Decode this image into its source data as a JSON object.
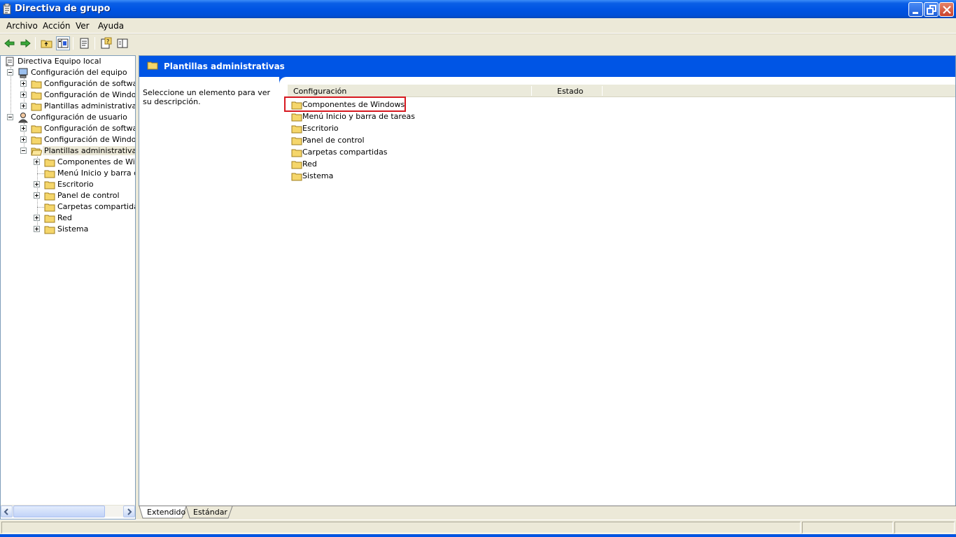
{
  "window": {
    "title": "Directiva de grupo",
    "controls": [
      "minimize",
      "maximize",
      "close"
    ]
  },
  "menu": [
    "Archivo",
    "Acción",
    "Ver",
    "Ayuda"
  ],
  "toolbar": {
    "buttons": [
      "back-arrow-icon",
      "forward-arrow-icon",
      "up-folder-icon",
      "show-tree-icon",
      "export-list-icon",
      "help-icon",
      "properties-icon"
    ]
  },
  "tree": {
    "root": "Directiva Equipo local",
    "computer": {
      "label": "Configuración del equipo",
      "children": [
        "Configuración de software",
        "Configuración de Windows",
        "Plantillas administrativas"
      ]
    },
    "user": {
      "label": "Configuración de usuario",
      "children": [
        "Configuración de software",
        "Configuración de Windows",
        "Plantillas administrativas"
      ],
      "templates_children": [
        "Componentes de Windo",
        "Menú Inicio y barra de",
        "Escritorio",
        "Panel de control",
        "Carpetas compartidas",
        "Red",
        "Sistema"
      ]
    }
  },
  "header": {
    "title": "Plantillas administrativas"
  },
  "description": "Seleccione un elemento para ver su descripción.",
  "list": {
    "columns": [
      "Configuración",
      "Estado"
    ],
    "items": [
      "Componentes de Windows",
      "Menú Inicio y barra de tareas",
      "Escritorio",
      "Panel de control",
      "Carpetas compartidas",
      "Red",
      "Sistema"
    ],
    "highlight_color": "#d71920"
  },
  "tabs": [
    "Extendido",
    "Estándar"
  ],
  "colors": {
    "titlebar": "#0054e3",
    "header_band": "#0055e5",
    "chrome": "#ece9d8"
  }
}
